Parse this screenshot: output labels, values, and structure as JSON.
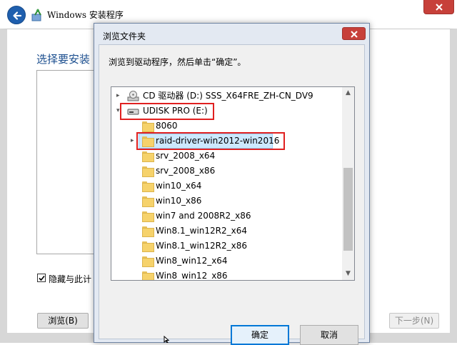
{
  "setup": {
    "title": "Windows 安装程序",
    "heading": "选择要安装",
    "hide_checkbox_label": "隐藏与此计",
    "hide_checked": true,
    "browse_button": "浏览(B)",
    "next_button": "下一步(N)"
  },
  "dialog": {
    "title": "浏览文件夹",
    "instruction": "浏览到驱动程序，然后单击“确定”。",
    "ok_button": "确定",
    "cancel_button": "取消",
    "tree": {
      "cd_drive": "CD 驱动器 (D:) SSS_X64FRE_ZH-CN_DV9",
      "usb_drive": "UDISK PRO (E:)",
      "folders": [
        "8060",
        "raid-driver-win2012-win2016",
        "srv_2008_x64",
        "srv_2008_x86",
        "win10_x64",
        "win10_x86",
        "win7 and 2008R2_x86",
        "Win8.1_win12R2_x64",
        "Win8.1_win12R2_x86",
        "Win8_win12_x64",
        "Win8_win12_x86"
      ],
      "selected_folder": "raid-driver-win2012-win2016"
    }
  },
  "colors": {
    "heading": "#1c4f8f",
    "highlight_box": "#e02020",
    "selection": "#cce8ff",
    "close_button": "#c7403a"
  },
  "icons": [
    "back-arrow-icon",
    "setup-icon",
    "close-icon",
    "cd-drive-icon",
    "usb-drive-icon",
    "folder-icon",
    "cursor-icon"
  ]
}
